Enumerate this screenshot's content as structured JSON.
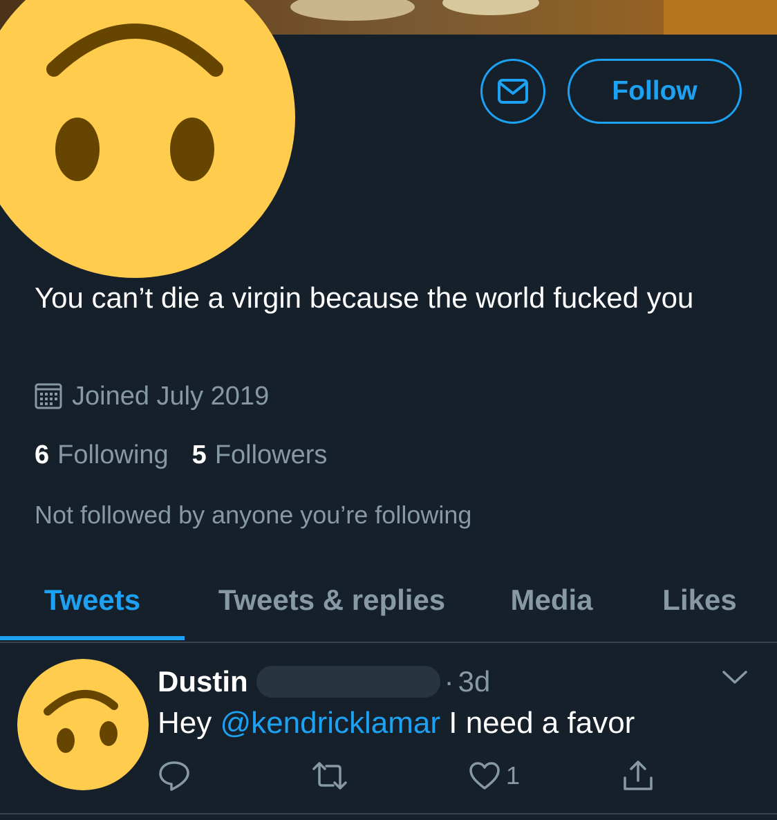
{
  "profile": {
    "bio": "You can’t die a virgin because the world fucked you",
    "joined": "Joined July 2019",
    "following_count": "6",
    "following_label": "Following",
    "followers_count": "5",
    "followers_label": "Followers",
    "not_followed_text": "Not followed by anyone you’re following"
  },
  "actions": {
    "follow_label": "Follow",
    "message_icon": "envelope-icon"
  },
  "tabs": [
    {
      "label": "Tweets",
      "active": true
    },
    {
      "label": "Tweets & replies",
      "active": false
    },
    {
      "label": "Media",
      "active": false
    },
    {
      "label": "Likes",
      "active": false
    }
  ],
  "tweet": {
    "author_name": "Dustin",
    "separator": "·",
    "time": "3d",
    "text_prefix": "Hey ",
    "mention": "@kendricklamar",
    "text_suffix": " I need a favor",
    "like_count": "1"
  },
  "colors": {
    "background": "#15202b",
    "accent": "#1da1f2",
    "secondary_text": "#8899a6",
    "emoji_yellow": "#ffcc4d",
    "emoji_brown": "#664500"
  }
}
